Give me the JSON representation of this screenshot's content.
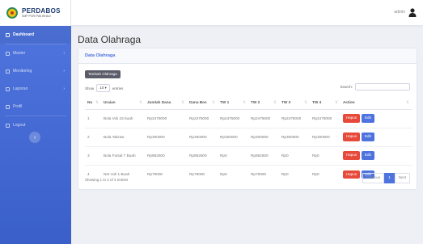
{
  "brand": {
    "name": "PERDABOS",
    "subtitle": "SMP PGRI PAKISHAJI"
  },
  "sidebar": {
    "items": [
      {
        "label": "Dashboard",
        "active": true,
        "chevron": false
      },
      {
        "label": "Master",
        "active": false,
        "chevron": true
      },
      {
        "label": "Monitoring",
        "active": false,
        "chevron": true
      },
      {
        "label": "Laporan",
        "active": false,
        "chevron": true
      },
      {
        "label": "Profil",
        "active": false,
        "chevron": false
      },
      {
        "label": "Logout",
        "active": false,
        "chevron": false
      }
    ],
    "toggle_glyph": "‹"
  },
  "topbar": {
    "user_name": "admin"
  },
  "page": {
    "title": "Data Olahraga"
  },
  "card": {
    "header": "Data Olahraga",
    "add_button": "Tambah Olahraga",
    "show_label": "Show",
    "entries_value": "10",
    "entries_label": "entries",
    "search_label": "Search:",
    "search_value": ""
  },
  "table": {
    "columns": [
      "No",
      "Uraian",
      "Jumlah Dana",
      "Dana Bos",
      "TW 1",
      "TW 2",
      "TW 3",
      "TW 4",
      "Action"
    ],
    "rows": [
      [
        "1",
        "Bola Voli 15 buah",
        "Rp2475000",
        "Rp2475000",
        "Rp2475000",
        "Rp2475000",
        "Rp2475000",
        "Rp2475000"
      ],
      [
        "2",
        "Bola Takraw",
        "Rp300000",
        "Rp300000",
        "Rp300000",
        "Rp300000",
        "Rp300000",
        "Rp300000"
      ],
      [
        "3",
        "Bola Futsal 7 Buah",
        "Rp882500",
        "Rp882500",
        "Rp0",
        "Rp882500",
        "Rp0",
        "Rp0"
      ],
      [
        "4",
        "Net Voli 1 Buah",
        "Rp79000",
        "Rp79000",
        "Rp0",
        "Rp79000",
        "Rp0",
        "Rp0"
      ]
    ],
    "delete_label": "Hapus",
    "edit_label": "Edit"
  },
  "footer": {
    "info": "Showing 1 to 4 of 4 entries",
    "previous": "Previous",
    "page": "1",
    "next": "Next"
  },
  "colors": {
    "primary": "#4e73df",
    "danger": "#e74a3b",
    "secondary": "#5a5c69"
  }
}
